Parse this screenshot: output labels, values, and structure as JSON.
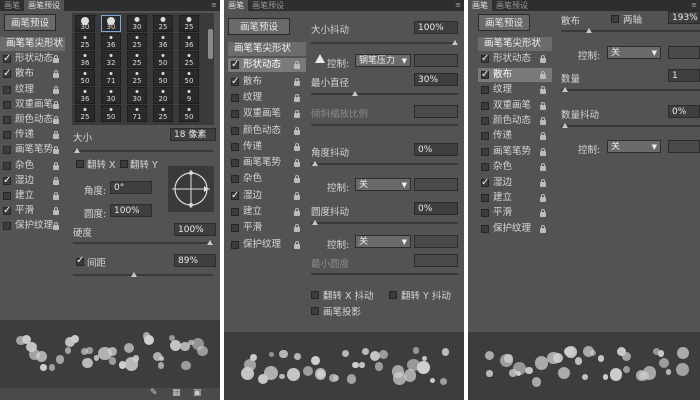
{
  "panel1": {
    "tabs": [
      "画笔",
      "画笔预设"
    ],
    "preset_button": "画笔预设",
    "sidebar": [
      {
        "label": "画笔笔尖形状",
        "checked": false,
        "header": true
      },
      {
        "label": "形状动态",
        "checked": true,
        "selected": false
      },
      {
        "label": "散布",
        "checked": true,
        "selected": false
      },
      {
        "label": "纹理",
        "checked": false
      },
      {
        "label": "双重画笔",
        "checked": false
      },
      {
        "label": "颜色动态",
        "checked": false
      },
      {
        "label": "传递",
        "checked": false
      },
      {
        "label": "画笔笔势",
        "checked": false
      },
      {
        "label": "杂色",
        "checked": false
      },
      {
        "label": "湿边",
        "checked": true
      },
      {
        "label": "建立",
        "checked": false
      },
      {
        "label": "平滑",
        "checked": true
      },
      {
        "label": "保护纹理",
        "checked": false
      }
    ],
    "tips": [
      {
        "size": "30"
      },
      {
        "size": "30"
      },
      {
        "size": "30"
      },
      {
        "size": "25"
      },
      {
        "size": "25"
      },
      {
        "size": "25"
      },
      {
        "size": "36"
      },
      {
        "size": "25"
      },
      {
        "size": "36"
      },
      {
        "size": "36"
      },
      {
        "size": "36"
      },
      {
        "size": "32"
      },
      {
        "size": "25"
      },
      {
        "size": "50"
      },
      {
        "size": "25"
      },
      {
        "size": "50"
      },
      {
        "size": "71"
      },
      {
        "size": "25"
      },
      {
        "size": "50"
      },
      {
        "size": "50"
      },
      {
        "size": "36"
      },
      {
        "size": "30"
      },
      {
        "size": "30"
      },
      {
        "size": "20"
      },
      {
        "size": "9"
      },
      {
        "size": "25"
      },
      {
        "size": "50"
      },
      {
        "size": "71"
      },
      {
        "size": "25"
      },
      {
        "size": "50"
      }
    ],
    "size_label": "大小",
    "size_value": "18 像素",
    "flip_x": "翻转 X",
    "flip_y": "翻转 Y",
    "angle_label": "角度:",
    "angle_value": "0°",
    "roundness_label": "圆度:",
    "roundness_value": "100%",
    "hardness_label": "硬度",
    "hardness_value": "100%",
    "spacing_label": "间距",
    "spacing_value": "89%",
    "spacing_checked": true
  },
  "panel2": {
    "tabs": [
      "画笔",
      "画笔预设"
    ],
    "preset_button": "画笔预设",
    "sidebar": [
      {
        "label": "画笔笔尖形状",
        "checked": false,
        "header": true
      },
      {
        "label": "形状动态",
        "checked": true,
        "selected": true
      },
      {
        "label": "散布",
        "checked": true
      },
      {
        "label": "纹理",
        "checked": false
      },
      {
        "label": "双重画笔",
        "checked": false
      },
      {
        "label": "颜色动态",
        "checked": false
      },
      {
        "label": "传递",
        "checked": false
      },
      {
        "label": "画笔笔势",
        "checked": false
      },
      {
        "label": "杂色",
        "checked": false
      },
      {
        "label": "湿边",
        "checked": true
      },
      {
        "label": "建立",
        "checked": false
      },
      {
        "label": "平滑",
        "checked": false
      },
      {
        "label": "保护纹理",
        "checked": false
      }
    ],
    "size_jitter_label": "大小抖动",
    "size_jitter_value": "100%",
    "control_label": "控制:",
    "control_value": "钢笔压力",
    "min_diameter_label": "最小直径",
    "min_diameter_value": "30%",
    "tilt_scale_label": "倾斜缩放比例",
    "angle_jitter_label": "角度抖动",
    "angle_jitter_value": "0%",
    "angle_control_label": "控制:",
    "angle_control_value": "关",
    "roundness_jitter_label": "圆度抖动",
    "roundness_jitter_value": "0%",
    "roundness_control_label": "控制:",
    "roundness_control_value": "关",
    "min_roundness_label": "最小圆度",
    "flip_x_jitter": "翻转 X 抖动",
    "flip_y_jitter": "翻转 Y 抖动",
    "brush_projection": "画笔投影"
  },
  "panel3": {
    "tabs": [
      "画笔",
      "画笔预设"
    ],
    "preset_button": "画笔预设",
    "sidebar": [
      {
        "label": "画笔笔尖形状",
        "checked": false,
        "header": true
      },
      {
        "label": "形状动态",
        "checked": true
      },
      {
        "label": "散布",
        "checked": true,
        "selected": true
      },
      {
        "label": "纹理",
        "checked": false
      },
      {
        "label": "双重画笔",
        "checked": false
      },
      {
        "label": "颜色动态",
        "checked": false
      },
      {
        "label": "传递",
        "checked": false
      },
      {
        "label": "画笔笔势",
        "checked": false
      },
      {
        "label": "杂色",
        "checked": false
      },
      {
        "label": "湿边",
        "checked": true
      },
      {
        "label": "建立",
        "checked": false
      },
      {
        "label": "平滑",
        "checked": false
      },
      {
        "label": "保护纹理",
        "checked": false
      }
    ],
    "scatter_label": "散布",
    "both_axes_label": "两轴",
    "scatter_value": "193%",
    "control_label": "控制:",
    "control_value": "关",
    "count_label": "数量",
    "count_value": "1",
    "count_jitter_label": "数量抖动",
    "count_jitter_value": "0%",
    "count_control_label": "控制:",
    "count_control_value": "关"
  },
  "colors": {
    "panel_bg": "#535353",
    "field_bg": "#3f3f3f",
    "tab_bar": "#2e2e2e",
    "selected_item": "#7a7a7a"
  }
}
